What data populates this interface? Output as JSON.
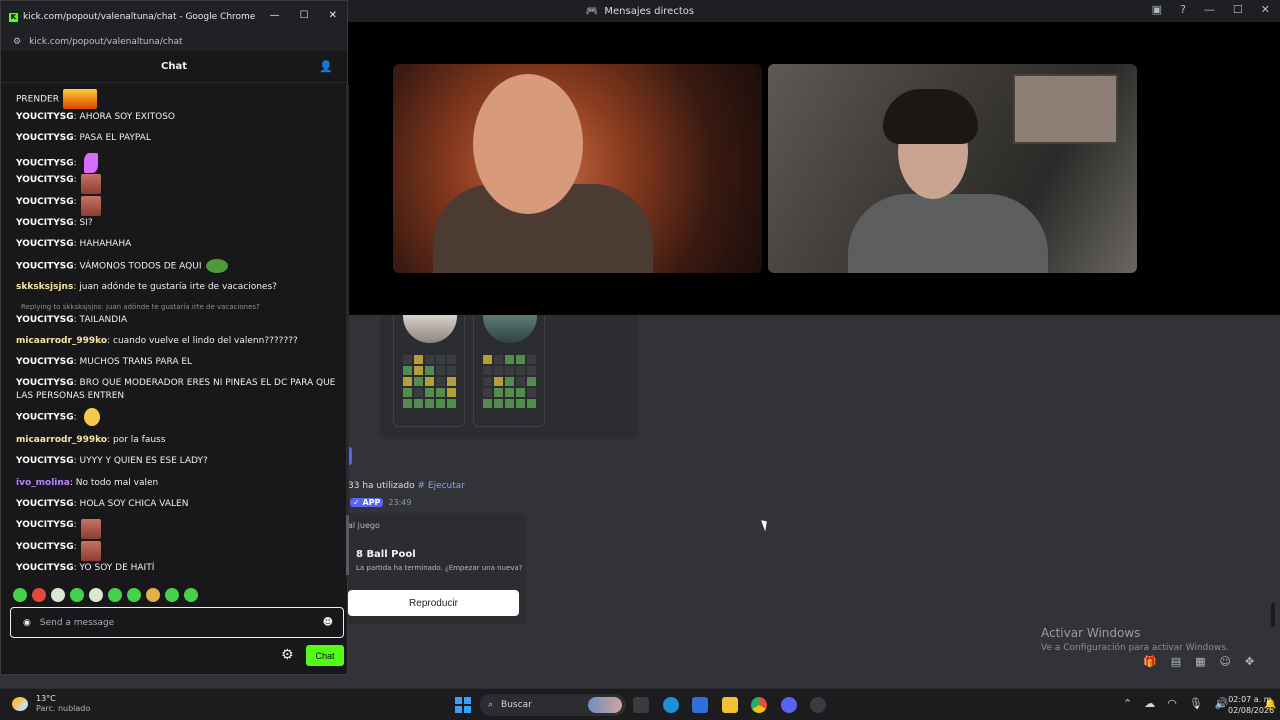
{
  "discord": {
    "title": "Mensajes directos",
    "wordle": {
      "players": [
        {
          "grid": [
            "e",
            "y",
            "e",
            "e",
            "e",
            "g",
            "y",
            "g",
            "e",
            "e",
            "y",
            "g",
            "y",
            "e",
            "y",
            "g",
            "e",
            "g",
            "g",
            "y",
            "g",
            "g",
            "g",
            "g",
            "g"
          ]
        },
        {
          "grid": [
            "y",
            "e",
            "g",
            "g",
            "e",
            "e",
            "e",
            "e",
            "e",
            "e",
            "e",
            "y",
            "g",
            "e",
            "g",
            "e",
            "g",
            "g",
            "g",
            "e",
            "g",
            "g",
            "g",
            "g",
            "g"
          ]
        }
      ]
    },
    "app_usage": {
      "user": "33",
      "text": "ha utilizado",
      "command": "# Ejecutar",
      "badge": "✓ APP",
      "time": "23:49"
    },
    "game_card": {
      "heading": "al juego",
      "name": "8 Ball Pool",
      "description": "La partida ha terminado. ¿Empezar una nueva?",
      "button": "Reproducir"
    },
    "activation": {
      "title": "Activar Windows",
      "subtitle": "Ve a Configuración para activar Windows."
    }
  },
  "chrome": {
    "window_title": "kick.com/popout/valenaltuna/chat - Google Chrome",
    "url": "kick.com/popout/valenaltuna/chat"
  },
  "chat": {
    "header": "Chat",
    "messages": [
      {
        "user": "",
        "text": "PRENDER",
        "emote": "fire"
      },
      {
        "user": "YOUCITYSG",
        "text": "AHORA SOY EXITOSO"
      },
      {
        "user": "YOUCITYSG",
        "text": "PASA EL PAYPAL"
      },
      {
        "user": "YOUCITYSG",
        "text": "",
        "emote": "pink"
      },
      {
        "user": "YOUCITYSG",
        "text": "",
        "emote": "face"
      },
      {
        "user": "YOUCITYSG",
        "text": "",
        "emote": "face"
      },
      {
        "user": "YOUCITYSG",
        "text": "SI?"
      },
      {
        "user": "YOUCITYSG",
        "text": "HAHAHAHA"
      },
      {
        "user": "YOUCITYSG",
        "text": "VÁMONOS TODOS DE AQUI",
        "emote": "frog"
      },
      {
        "user": "skksksjsjns",
        "text": "juan adónde te gustaría irte de vacaciones?"
      },
      {
        "reply": "Replying to skksksjsjns: juan adónde te gustaría irte de vacaciones?"
      },
      {
        "user": "YOUCITYSG",
        "text": "TAILANDIA"
      },
      {
        "user": "micaarrodr_999ko",
        "text": "cuando vuelve el lindo del valenn???????"
      },
      {
        "user": "YOUCITYSG",
        "text": "MUCHOS TRANS PARA EL"
      },
      {
        "user": "YOUCITYSG",
        "text": "BRO QUE MODERADOR ERES NI PINEAS EL DC PARA QUE LAS PERSONAS ENTREN"
      },
      {
        "user": "YOUCITYSG",
        "text": "",
        "emote": "yellowface"
      },
      {
        "user": "micaarrodr_999ko",
        "text": "por la fauss"
      },
      {
        "user": "YOUCITYSG",
        "text": "UYYY Y QUIEN ES ESE LADY?"
      },
      {
        "user": "ivo_molina",
        "text": "No todo mal valen"
      },
      {
        "user": "YOUCITYSG",
        "text": "HOLA SOY CHICA VALEN"
      },
      {
        "user": "YOUCITYSG",
        "text": "",
        "emote": "face"
      },
      {
        "user": "YOUCITYSG",
        "text": "",
        "emote": "face"
      },
      {
        "user": "YOUCITYSG",
        "text": "YO SOY DE HAITÍ"
      }
    ],
    "input_placeholder": "Send a message",
    "send_button": "Chat"
  },
  "taskbar": {
    "temperature": "13°C",
    "weather": "Parc. nublado",
    "search": "Buscar",
    "time": "02:07 a. m.",
    "date": "02/08/2026"
  },
  "colors": {
    "kick_green": "#53fc18",
    "discord_bg": "#313338",
    "chat_bg": "#18181b",
    "discord_blurple": "#5865f2"
  }
}
